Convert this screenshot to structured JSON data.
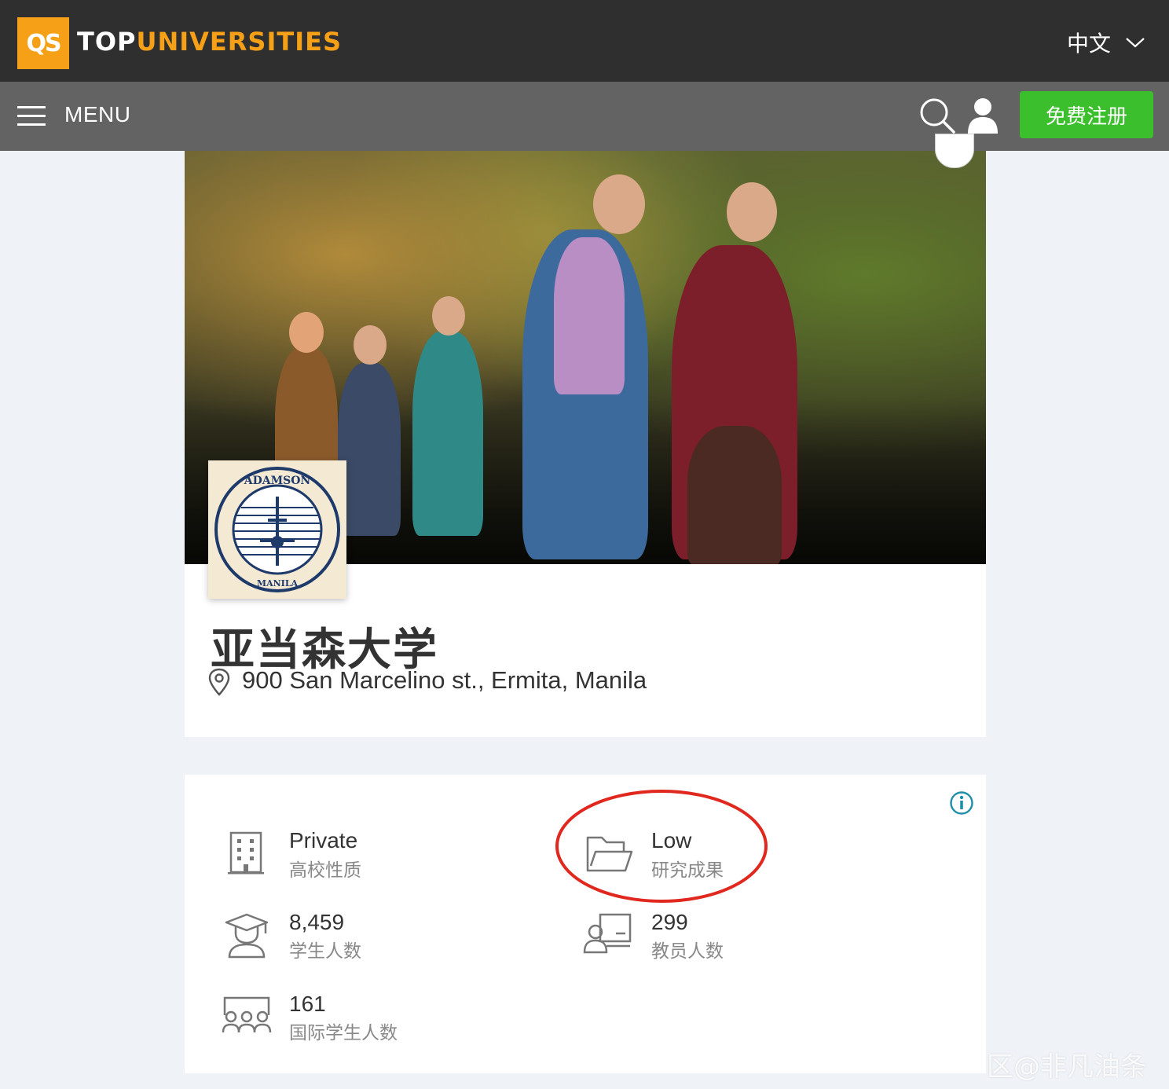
{
  "header": {
    "logo_badge": "QS",
    "logo_part1": "TOP",
    "logo_part2": "UNIVERSITIES",
    "language": "中文"
  },
  "nav": {
    "menu_label": "MENU",
    "signup_label": "免费注册"
  },
  "university": {
    "name": "亚当森大学",
    "address": "900 San Marcelino st., Ermita, Manila"
  },
  "stats": [
    {
      "value": "Private",
      "label": "高校性质",
      "icon": "building-icon"
    },
    {
      "value": "Low",
      "label": "研究成果",
      "icon": "folder-icon"
    },
    {
      "value": "8,459",
      "label": "学生人数",
      "icon": "graduate-icon"
    },
    {
      "value": "299",
      "label": "教员人数",
      "icon": "teacher-icon"
    },
    {
      "value": "161",
      "label": "国际学生人数",
      "icon": "group-icon"
    }
  ],
  "watermark": "区@非凡油条",
  "colors": {
    "brand_orange": "#f6a017",
    "signup_green": "#3bbf2d",
    "annotation_red": "#e0281e"
  }
}
